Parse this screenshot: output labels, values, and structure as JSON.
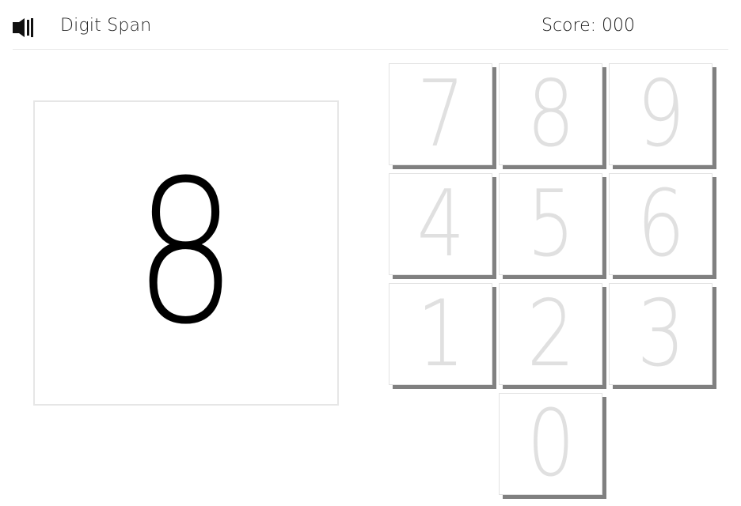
{
  "header": {
    "sound_icon": "speaker-icon",
    "title": "Digit Span",
    "score_text": "Score: 000"
  },
  "display": {
    "current_digit": "8"
  },
  "keypad": {
    "keys": [
      "7",
      "8",
      "9",
      "4",
      "5",
      "6",
      "1",
      "2",
      "3",
      "0"
    ]
  },
  "colors": {
    "key_text": "#e0e0e0",
    "key_shadow": "#808080",
    "display_digit": "#000000",
    "border": "#e6e6e6"
  }
}
